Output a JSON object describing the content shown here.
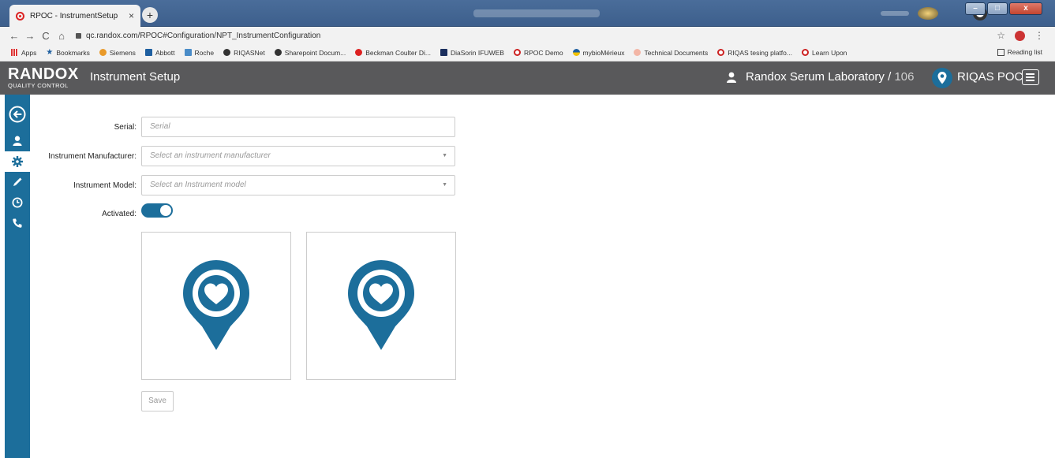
{
  "browser": {
    "tab_title": "RPOC - InstrumentSetup",
    "tab_close": "×",
    "new_tab": "+",
    "url": "qc.randox.com/RPOC#Configuration/NPT_InstrumentConfiguration",
    "nav": {
      "back": "←",
      "forward": "→",
      "reload": "C",
      "home": "⌂"
    },
    "bookmark_star": "☆",
    "more": "⋮",
    "bookmarks": [
      {
        "label": "Apps",
        "icon": "apps-grid-icon"
      },
      {
        "label": "Bookmarks",
        "icon": "star-icon"
      },
      {
        "label": "Siemens",
        "icon": "siemens-icon"
      },
      {
        "label": "Abbott",
        "icon": "abbott-icon"
      },
      {
        "label": "Roche",
        "icon": "roche-icon"
      },
      {
        "label": "RIQASNet",
        "icon": "globe-icon"
      },
      {
        "label": "Sharepoint Docum...",
        "icon": "globe-icon"
      },
      {
        "label": "Beckman Coulter Di...",
        "icon": "beckman-icon"
      },
      {
        "label": "DiaSorin IFUWEB",
        "icon": "diasorin-icon"
      },
      {
        "label": "RPOC Demo",
        "icon": "rpoc-icon"
      },
      {
        "label": "mybioMérieux",
        "icon": "biomerieux-icon"
      },
      {
        "label": "Technical Documents",
        "icon": "document-icon"
      },
      {
        "label": "RIQAS tesing platfo...",
        "icon": "rpoc-icon"
      },
      {
        "label": "Learn Upon",
        "icon": "rpoc-icon"
      }
    ],
    "reading_list": "Reading list"
  },
  "app": {
    "logo_main": "RANDOX",
    "logo_sub": "QUALITY CONTROL",
    "title": "Instrument Setup",
    "lab_name": "Randox Serum Laboratory /",
    "lab_number": "106",
    "product": "RIQAS POC"
  },
  "sidebar": {
    "items": [
      {
        "name": "back-icon"
      },
      {
        "name": "user-icon"
      },
      {
        "name": "gear-icon"
      },
      {
        "name": "pencil-icon"
      },
      {
        "name": "clock-icon"
      },
      {
        "name": "phone-icon"
      }
    ]
  },
  "form": {
    "serial_label": "Serial:",
    "serial_placeholder": "Serial",
    "manufacturer_label": "Instrument Manufacturer:",
    "manufacturer_placeholder": "Select an instrument manufacturer",
    "model_label": "Instrument Model:",
    "model_placeholder": "Select an Instrument model",
    "activated_label": "Activated:",
    "activated": true,
    "dropdown_caret": "▼",
    "save_label": "Save"
  },
  "colors": {
    "brand": "#1c6e9b",
    "header": "#59595b"
  }
}
